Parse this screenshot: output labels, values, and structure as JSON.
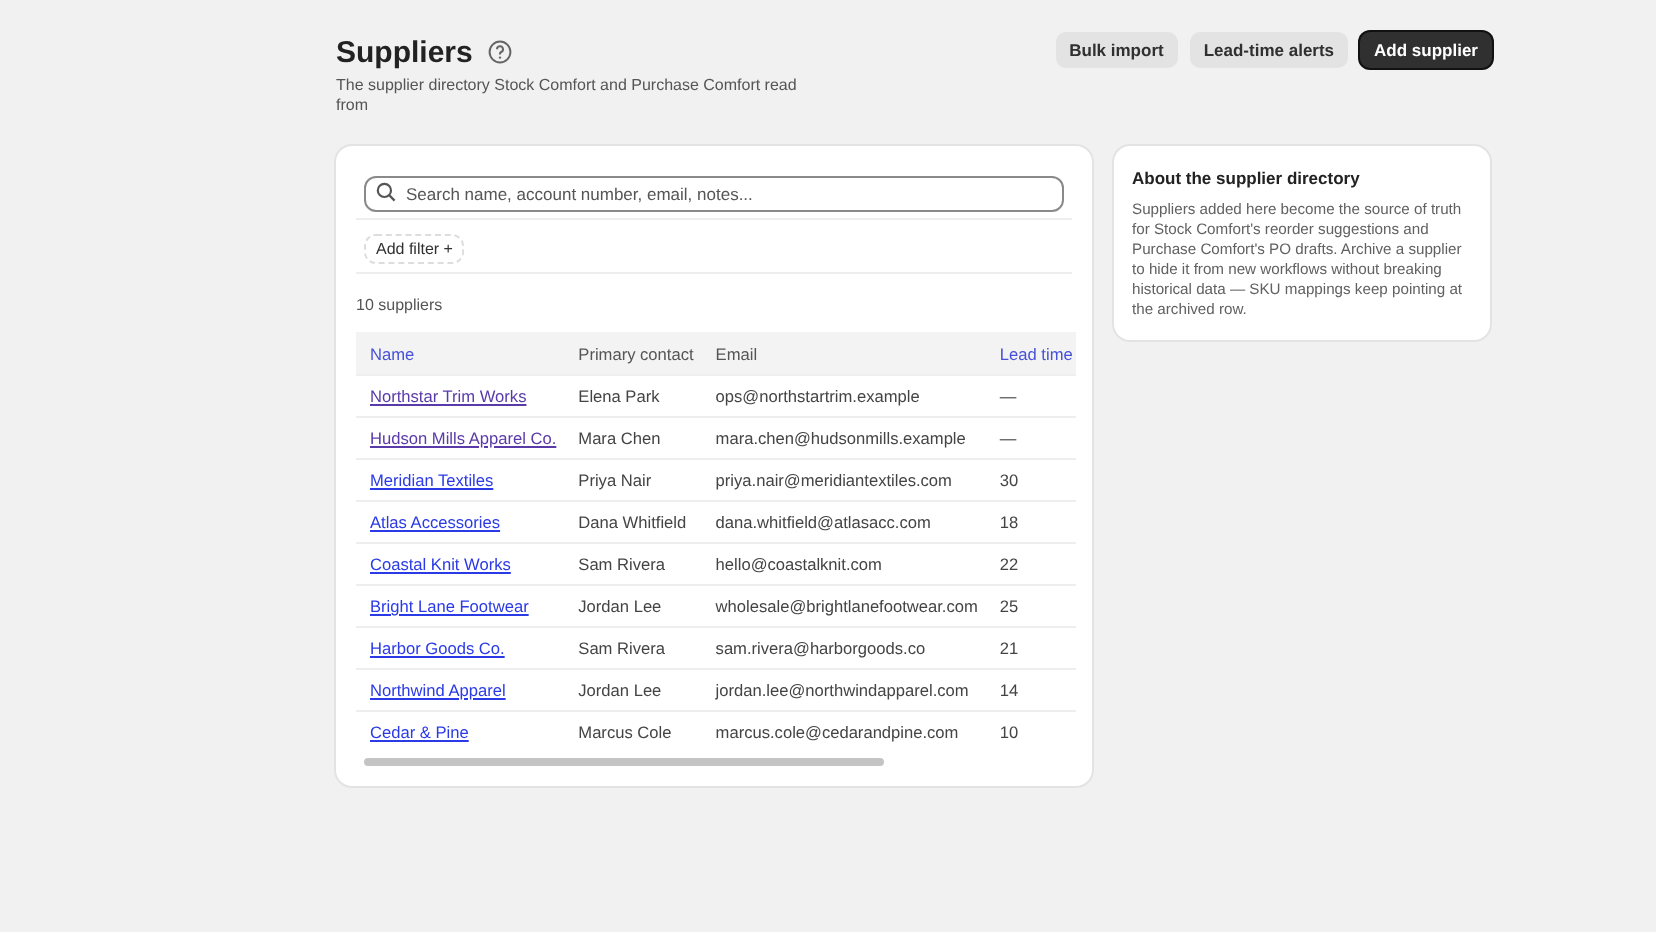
{
  "header": {
    "title": "Suppliers",
    "subtitle": "The supplier directory Stock Comfort and Purchase Comfort read from",
    "actions": [
      {
        "label": "Bulk import",
        "kind": "secondary"
      },
      {
        "label": "Lead-time alerts",
        "kind": "secondary"
      },
      {
        "label": "Add supplier",
        "kind": "primary"
      }
    ]
  },
  "search": {
    "placeholder": "Search name, account number, email, notes..."
  },
  "filter_button": "Add filter +",
  "count": "10 suppliers",
  "table": {
    "columns": [
      "Name",
      "Primary contact",
      "Email",
      "Lead time"
    ],
    "rows": [
      {
        "name": "Northstar Trim Works",
        "visited": true,
        "contact": "Elena Park",
        "email": "ops@northstartrim.example",
        "lead_time": "—"
      },
      {
        "name": "Hudson Mills Apparel Co.",
        "visited": true,
        "contact": "Mara Chen",
        "email": "mara.chen@hudsonmills.example",
        "lead_time": "—"
      },
      {
        "name": "Meridian Textiles",
        "visited": false,
        "contact": "Priya Nair",
        "email": "priya.nair@meridiantextiles.com",
        "lead_time": "30"
      },
      {
        "name": "Atlas Accessories",
        "visited": false,
        "contact": "Dana Whitfield",
        "email": "dana.whitfield@atlasacc.com",
        "lead_time": "18"
      },
      {
        "name": "Coastal Knit Works",
        "visited": false,
        "contact": "Sam Rivera",
        "email": "hello@coastalknit.com",
        "lead_time": "22"
      },
      {
        "name": "Bright Lane Footwear",
        "visited": false,
        "contact": "Jordan Lee",
        "email": "wholesale@brightlanefootwear.com",
        "lead_time": "25"
      },
      {
        "name": "Harbor Goods Co.",
        "visited": false,
        "contact": "Sam Rivera",
        "email": "sam.rivera@harborgoods.co",
        "lead_time": "21"
      },
      {
        "name": "Northwind Apparel",
        "visited": false,
        "contact": "Jordan Lee",
        "email": "jordan.lee@northwindapparel.com",
        "lead_time": "14"
      },
      {
        "name": "Cedar & Pine",
        "visited": false,
        "contact": "Marcus Cole",
        "email": "marcus.cole@cedarandpine.com",
        "lead_time": "10"
      }
    ]
  },
  "info_card": {
    "title": "About the supplier directory",
    "body": "Suppliers added here become the source of truth for Stock Comfort's reorder suggestions and Purchase Comfort's PO drafts. Archive a supplier to hide it from new workflows without breaking historical data — SKU mappings keep pointing at the archived row."
  }
}
